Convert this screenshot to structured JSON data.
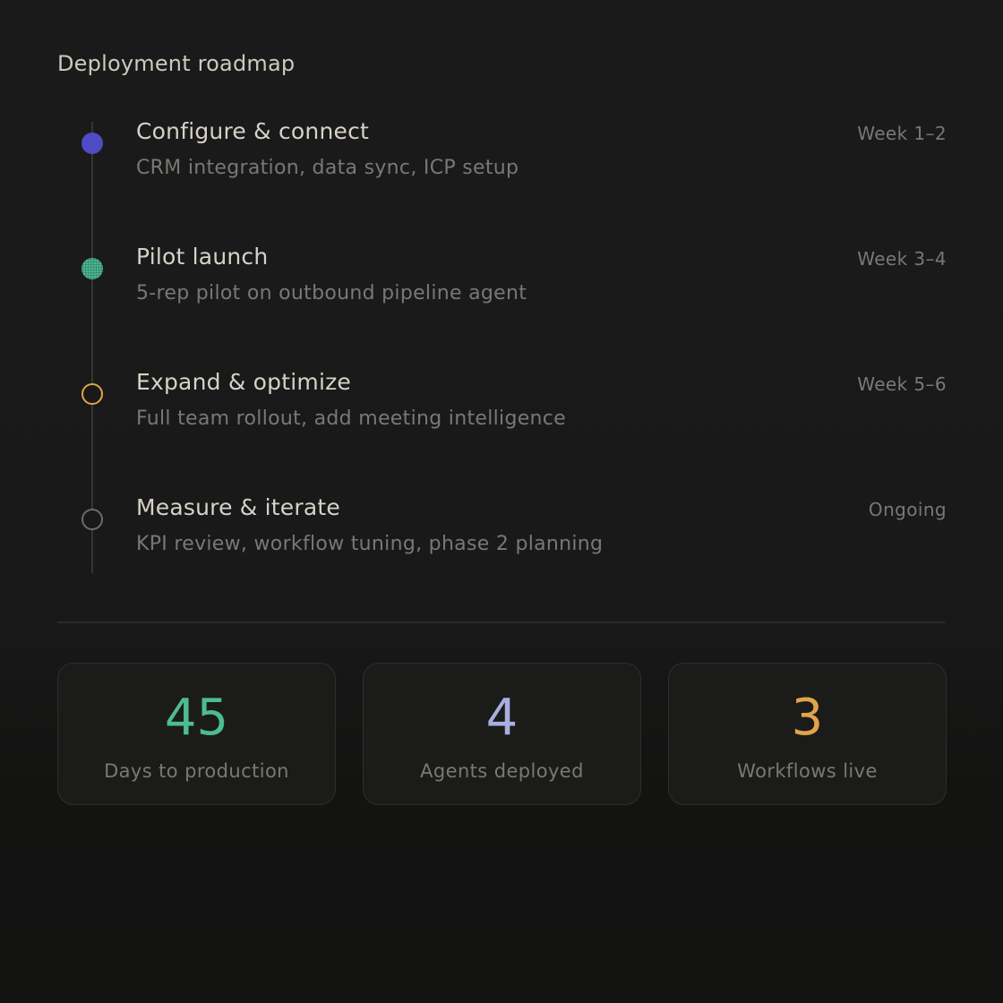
{
  "roadmap": {
    "title": "Deployment roadmap",
    "steps": [
      {
        "title": "Configure & connect",
        "description": "CRM integration, data sync, ICP setup",
        "timing": "Week 1–2",
        "marker_style": "filled",
        "color": "#4f4bc4"
      },
      {
        "title": "Pilot launch",
        "description": "5-rep pilot on outbound pipeline agent",
        "timing": "Week 3–4",
        "marker_style": "dotted",
        "color": "#4dbb94"
      },
      {
        "title": "Expand & optimize",
        "description": "Full team rollout, add meeting intelligence",
        "timing": "Week 5–6",
        "marker_style": "ring",
        "color": "#e1a44a"
      },
      {
        "title": "Measure & iterate",
        "description": "KPI review, workflow tuning, phase 2 planning",
        "timing": "Ongoing",
        "marker_style": "ring",
        "color": "#6e6c68"
      }
    ]
  },
  "stats": [
    {
      "value": "45",
      "label": "Days to production",
      "color": "#4dbb94"
    },
    {
      "value": "4",
      "label": "Agents deployed",
      "color": "#a9aee0"
    },
    {
      "value": "3",
      "label": "Workflows live",
      "color": "#e1a44a"
    }
  ]
}
